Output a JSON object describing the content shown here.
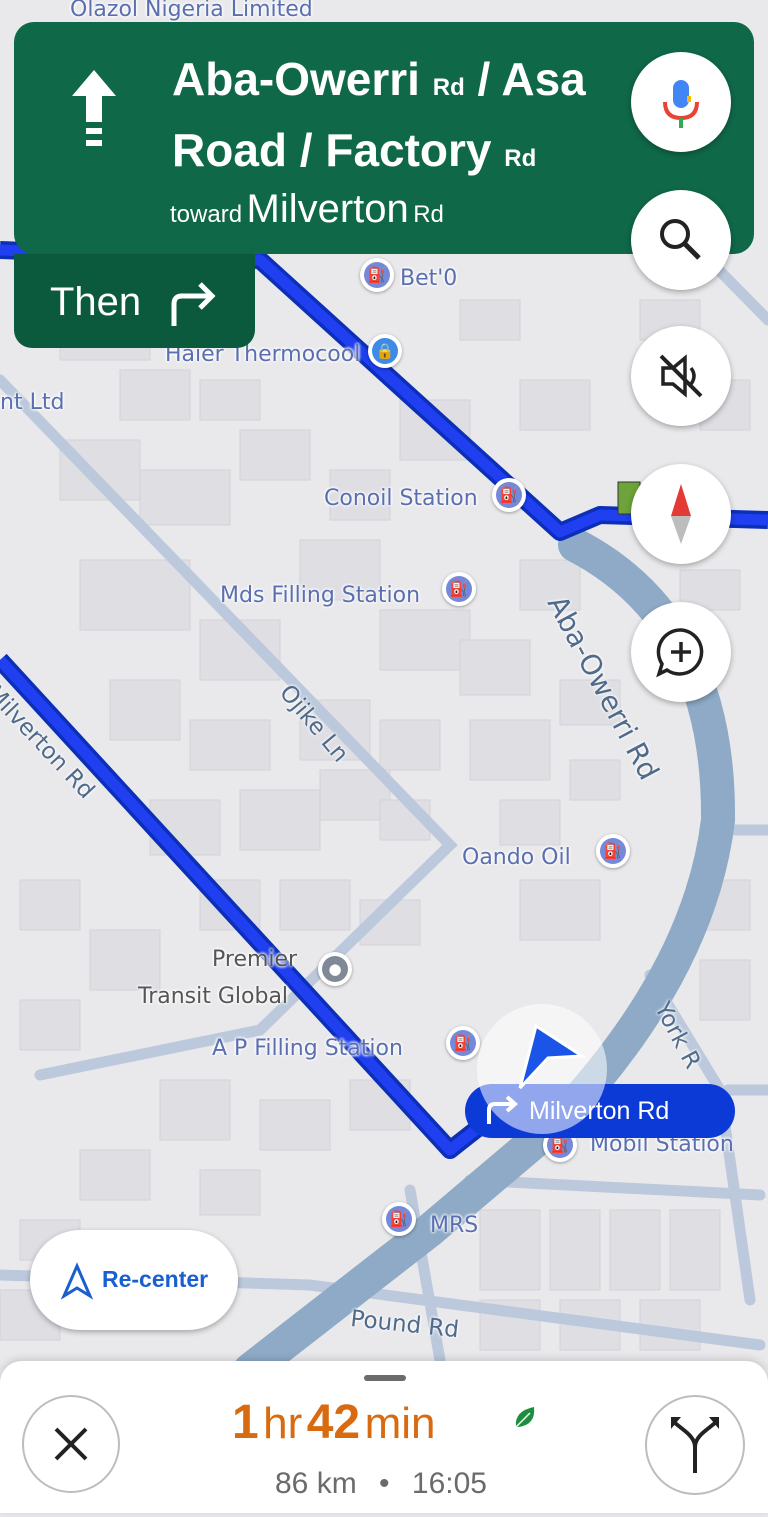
{
  "map": {
    "labels": {
      "top_business": "Olazol Nigeria Limited",
      "bet": "Bet'0",
      "haier": "Haier Thermocool",
      "nt_ltd": "nt Ltd",
      "conoil": "Conoil Station",
      "mds": "Mds Filling Station",
      "oando": "Oando Oil",
      "premier": "Premier",
      "transit": "Transit Global",
      "ap": "A P Filling Station",
      "mobil": "Mobil Station",
      "mrs": "MRS"
    },
    "roads": {
      "aba": "Aba-Owerri Rd",
      "milverton": "Milverton Rd",
      "ojike": "Ojike Ln",
      "york": "York R",
      "pound": "Pound Rd"
    },
    "route_color": "#1a34e0"
  },
  "navigation": {
    "street_line1_main": "Aba-Owerri",
    "street_line1_suffix": "Rd",
    "street_line1_rest": "/ Asa",
    "street_line2_main": "Road / Factory",
    "street_line2_suffix": "Rd",
    "toward_label": "toward",
    "toward_name": "Milverton",
    "toward_suffix": "Rd",
    "then_label": "Then",
    "header_color": "#0f6848"
  },
  "controls": {
    "recenter_label": "Re-center",
    "next_turn_label": "Milverton Rd"
  },
  "trip": {
    "hours_num": "1",
    "hours_unit": "hr",
    "minutes_num": "42",
    "minutes_unit": "min",
    "distance": "86 km",
    "separator": "•",
    "arrival": "16:05",
    "eta_color": "#d86a10"
  }
}
